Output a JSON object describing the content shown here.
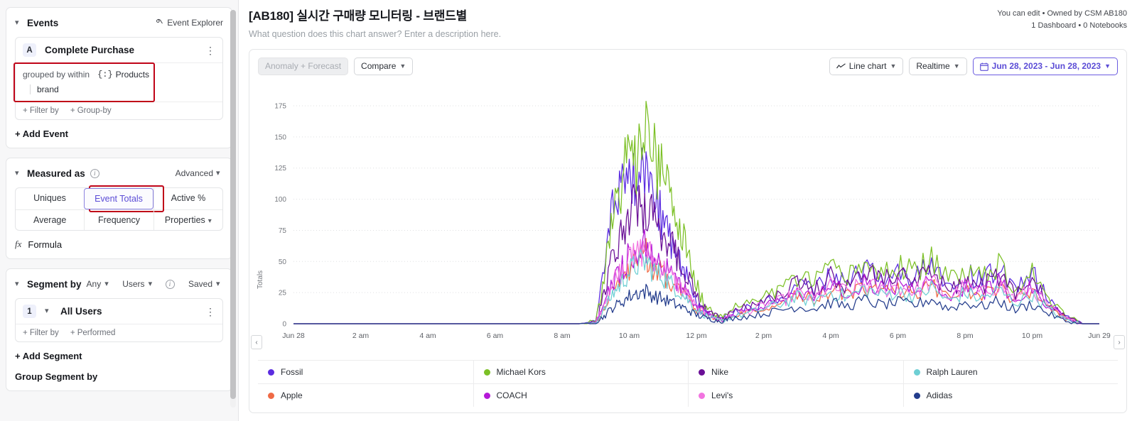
{
  "sidebar": {
    "events": {
      "title": "Events",
      "explorer_label": "Event Explorer",
      "event": {
        "badge": "A",
        "name": "Complete Purchase",
        "group_label": "grouped by within",
        "group_property": "Products",
        "group_sub": "brand",
        "filter_by": "+ Filter by",
        "group_by": "+ Group-by"
      },
      "add_event": "+ Add Event"
    },
    "measured_as": {
      "title": "Measured as",
      "advanced": "Advanced",
      "options_row1": [
        "Uniques",
        "Event Totals",
        "Active %"
      ],
      "options_row2": [
        "Average",
        "Frequency",
        "Properties"
      ],
      "selected": "Event Totals",
      "formula": "Formula"
    },
    "segment_by": {
      "title": "Segment by",
      "any": "Any",
      "users": "Users",
      "saved": "Saved",
      "segment": {
        "number": "1",
        "name": "All Users",
        "filter_by": "+ Filter by",
        "performed": "+ Performed"
      },
      "add_segment": "+ Add Segment",
      "group_segment_by": "Group Segment by"
    }
  },
  "header": {
    "title": "[AB180] 실시간 구매량 모니터링 - 브랜드별",
    "subtitle": "What question does this chart answer? Enter a description here.",
    "meta_line1": "You can edit • Owned by CSM AB180",
    "meta_line2": "1 Dashboard • 0 Notebooks"
  },
  "toolbar": {
    "anomaly_forecast": "Anomaly + Forecast",
    "compare": "Compare",
    "chart_type": "Line chart",
    "granularity": "Realtime",
    "date_range": "Jun 28, 2023 - Jun 28, 2023"
  },
  "chart_data": {
    "type": "line",
    "title": "",
    "xlabel": "",
    "ylabel": "Totals",
    "ylim": [
      0,
      187
    ],
    "yticks": [
      0,
      25,
      50,
      75,
      100,
      125,
      150,
      175
    ],
    "xticks": [
      "Jun 28",
      "2 am",
      "4 am",
      "6 am",
      "8 am",
      "10 am",
      "12 pm",
      "2 pm",
      "4 pm",
      "6 pm",
      "8 pm",
      "10 pm",
      "Jun 29"
    ],
    "grid": true,
    "legend_position": "bottom",
    "x_hours": [
      0,
      0.5,
      1,
      1.5,
      2,
      2.5,
      3,
      3.5,
      4,
      4.5,
      5,
      5.5,
      6,
      6.5,
      7,
      7.5,
      8,
      8.5,
      9,
      9.25,
      9.5,
      9.75,
      10,
      10.25,
      10.5,
      10.75,
      11,
      11.25,
      11.5,
      11.75,
      12,
      12.25,
      12.5,
      12.75,
      13,
      13.5,
      14,
      14.5,
      15,
      15.5,
      16,
      16.5,
      17,
      17.5,
      18,
      18.5,
      19,
      19.5,
      20,
      20.5,
      21,
      21.5,
      22,
      22.5,
      23,
      23.5,
      24
    ],
    "series": [
      {
        "name": "Fossil",
        "color": "#5b2ce0",
        "values": [
          0,
          0,
          0,
          0,
          0,
          0,
          0,
          0,
          0,
          0,
          0,
          0,
          0,
          0,
          0,
          0,
          0,
          0,
          2,
          40,
          90,
          105,
          128,
          118,
          122,
          100,
          86,
          62,
          48,
          36,
          18,
          10,
          6,
          4,
          8,
          12,
          16,
          22,
          30,
          26,
          40,
          34,
          44,
          36,
          42,
          38,
          46,
          30,
          42,
          34,
          44,
          28,
          40,
          18,
          6,
          0,
          0
        ]
      },
      {
        "name": "Apple",
        "color": "#ef6a45",
        "values": [
          0,
          0,
          0,
          0,
          0,
          0,
          0,
          0,
          0,
          0,
          0,
          0,
          0,
          0,
          0,
          0,
          0,
          0,
          1,
          12,
          26,
          34,
          46,
          52,
          56,
          44,
          40,
          34,
          28,
          20,
          12,
          8,
          5,
          3,
          6,
          9,
          13,
          17,
          22,
          19,
          28,
          23,
          30,
          25,
          28,
          24,
          32,
          20,
          29,
          23,
          30,
          19,
          27,
          13,
          4,
          0,
          0
        ]
      },
      {
        "name": "Michael Kors",
        "color": "#7cc026",
        "values": [
          0,
          0,
          0,
          0,
          0,
          0,
          0,
          0,
          0,
          0,
          0,
          0,
          0,
          0,
          0,
          0,
          0,
          0,
          2,
          36,
          86,
          108,
          136,
          128,
          150,
          132,
          118,
          96,
          74,
          58,
          30,
          16,
          9,
          5,
          11,
          16,
          22,
          28,
          36,
          32,
          44,
          38,
          48,
          40,
          46,
          42,
          50,
          34,
          46,
          38,
          48,
          30,
          42,
          20,
          7,
          0,
          0
        ]
      },
      {
        "name": "Nike",
        "color": "#6a0f96",
        "values": [
          0,
          0,
          0,
          0,
          0,
          0,
          0,
          0,
          0,
          0,
          0,
          0,
          0,
          0,
          0,
          0,
          0,
          0,
          1,
          22,
          54,
          72,
          88,
          94,
          90,
          82,
          74,
          62,
          50,
          40,
          22,
          12,
          7,
          4,
          9,
          13,
          18,
          24,
          32,
          28,
          38,
          32,
          42,
          34,
          38,
          32,
          42,
          26,
          36,
          30,
          40,
          24,
          34,
          16,
          5,
          0,
          0
        ]
      },
      {
        "name": "COACH",
        "color": "#b519d8",
        "values": [
          0,
          0,
          0,
          0,
          0,
          0,
          0,
          0,
          0,
          0,
          0,
          0,
          0,
          0,
          0,
          0,
          0,
          0,
          1,
          16,
          34,
          44,
          54,
          58,
          62,
          52,
          46,
          40,
          32,
          24,
          14,
          9,
          5,
          3,
          7,
          10,
          14,
          19,
          25,
          21,
          31,
          26,
          34,
          28,
          31,
          27,
          35,
          22,
          31,
          25,
          33,
          21,
          29,
          14,
          4,
          0,
          0
        ]
      },
      {
        "name": "Levi's",
        "color": "#f274e0",
        "values": [
          0,
          0,
          0,
          0,
          0,
          0,
          0,
          0,
          0,
          0,
          0,
          0,
          0,
          0,
          0,
          0,
          0,
          0,
          1,
          14,
          32,
          42,
          52,
          56,
          60,
          50,
          44,
          38,
          30,
          22,
          13,
          8,
          5,
          3,
          6,
          10,
          14,
          18,
          24,
          20,
          30,
          25,
          32,
          27,
          30,
          26,
          34,
          21,
          30,
          24,
          32,
          20,
          28,
          13,
          4,
          0,
          0
        ]
      },
      {
        "name": "Ralph Lauren",
        "color": "#6ecfd4",
        "values": [
          0,
          0,
          0,
          0,
          0,
          0,
          0,
          0,
          0,
          0,
          0,
          0,
          0,
          0,
          0,
          0,
          0,
          0,
          1,
          11,
          24,
          32,
          42,
          48,
          50,
          42,
          38,
          32,
          26,
          19,
          11,
          7,
          4,
          2,
          5,
          8,
          12,
          16,
          21,
          18,
          26,
          21,
          28,
          23,
          26,
          22,
          29,
          18,
          25,
          20,
          27,
          17,
          24,
          11,
          3,
          0,
          0
        ]
      },
      {
        "name": "Adidas",
        "color": "#233c8c",
        "values": [
          0,
          0,
          0,
          0,
          0,
          0,
          0,
          0,
          0,
          0,
          0,
          0,
          0,
          0,
          0,
          0,
          0,
          0,
          1,
          6,
          13,
          17,
          22,
          25,
          26,
          22,
          20,
          17,
          14,
          11,
          7,
          5,
          3,
          2,
          4,
          6,
          8,
          11,
          14,
          12,
          17,
          14,
          19,
          15,
          17,
          15,
          20,
          12,
          17,
          14,
          18,
          11,
          16,
          8,
          2,
          0,
          0
        ]
      }
    ]
  },
  "nav": {
    "prev": "‹",
    "next": "›"
  }
}
